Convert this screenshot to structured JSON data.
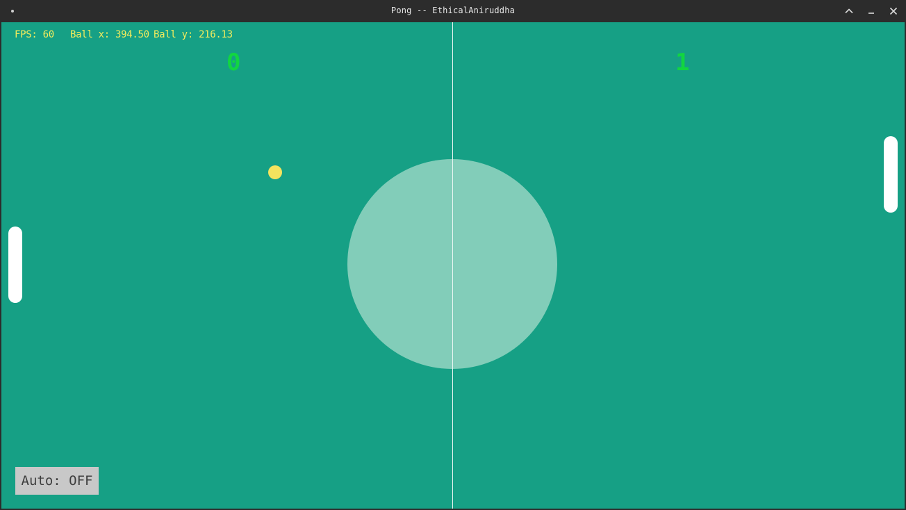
{
  "window": {
    "title": "Pong -- EthicalAniruddha",
    "buttons": [
      "chevron-up-icon",
      "minimize-icon",
      "close-icon"
    ]
  },
  "hud": {
    "fps": "FPS: 60",
    "ball_x": "Ball x: 394.50",
    "ball_y": "Ball y: 216.13"
  },
  "scores": {
    "left": "0",
    "right": "1"
  },
  "auto_button": {
    "label": "Auto: OFF"
  },
  "colors": {
    "field": "#16a085",
    "center_circle": "#82cdb9",
    "score": "#11d640",
    "hud_text": "#f4ec5c",
    "ball": "#f4e35e",
    "paddle": "#ffffff",
    "button_bg": "#c8c8c8"
  }
}
